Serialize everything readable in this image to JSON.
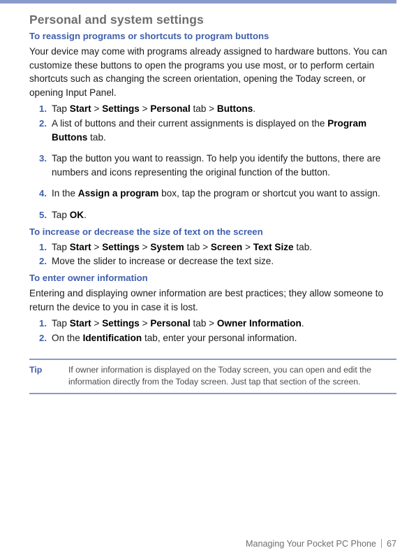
{
  "document": {
    "title": "Personal and system settings",
    "sections": [
      {
        "heading": "To reassign programs or shortcuts to program buttons",
        "intro": "Your device may come with programs already assigned to hardware buttons. You can customize these buttons to open the programs you use most, or to perform certain shortcuts such as changing the screen orientation, opening the Today screen, or opening Input Panel.",
        "steps": [
          {
            "num": "1.",
            "parts": [
              {
                "t": "Tap ",
                "b": false
              },
              {
                "t": "Start",
                "b": true
              },
              {
                "t": " > ",
                "b": false
              },
              {
                "t": "Settings",
                "b": true
              },
              {
                "t": " > ",
                "b": false
              },
              {
                "t": "Personal",
                "b": true
              },
              {
                "t": " tab > ",
                "b": false
              },
              {
                "t": "Buttons",
                "b": true
              },
              {
                "t": ".",
                "b": false
              }
            ]
          },
          {
            "num": "2.",
            "parts": [
              {
                "t": "A list of buttons and their current assignments is displayed on the ",
                "b": false
              },
              {
                "t": "Program Buttons",
                "b": true
              },
              {
                "t": " tab.",
                "b": false
              }
            ]
          },
          {
            "num": "3.",
            "gap": true,
            "parts": [
              {
                "t": "Tap the button you want to reassign. To help you identify the buttons, there are numbers and icons representing the original function of the button.",
                "b": false
              }
            ]
          },
          {
            "num": "4.",
            "gap": true,
            "parts": [
              {
                "t": "In the ",
                "b": false
              },
              {
                "t": "Assign a program",
                "b": true
              },
              {
                "t": " box, tap the program or shortcut you want to assign.",
                "b": false
              }
            ]
          },
          {
            "num": "5.",
            "gap": true,
            "parts": [
              {
                "t": "Tap ",
                "b": false
              },
              {
                "t": "OK",
                "b": true
              },
              {
                "t": ".",
                "b": false
              }
            ]
          }
        ]
      },
      {
        "heading": "To increase or decrease the size of text on the screen",
        "steps": [
          {
            "num": "1.",
            "parts": [
              {
                "t": "Tap ",
                "b": false
              },
              {
                "t": "Start",
                "b": true
              },
              {
                "t": " > ",
                "b": false
              },
              {
                "t": "Settings",
                "b": true
              },
              {
                "t": " > ",
                "b": false
              },
              {
                "t": "System",
                "b": true
              },
              {
                "t": " tab > ",
                "b": false
              },
              {
                "t": "Screen",
                "b": true
              },
              {
                "t": " > ",
                "b": false
              },
              {
                "t": "Text Size",
                "b": true
              },
              {
                "t": " tab.",
                "b": false
              }
            ]
          },
          {
            "num": "2.",
            "parts": [
              {
                "t": "Move the slider to increase or decrease the text size.",
                "b": false
              }
            ]
          }
        ]
      },
      {
        "heading": "To enter owner information",
        "intro": "Entering and displaying owner information are best practices; they allow someone to return the device to you in case it is lost.",
        "steps": [
          {
            "num": "1.",
            "parts": [
              {
                "t": "Tap ",
                "b": false
              },
              {
                "t": "Start",
                "b": true
              },
              {
                "t": " > ",
                "b": false
              },
              {
                "t": "Settings",
                "b": true
              },
              {
                "t": " > ",
                "b": false
              },
              {
                "t": "Personal",
                "b": true
              },
              {
                "t": " tab > ",
                "b": false
              },
              {
                "t": "Owner Information",
                "b": true
              },
              {
                "t": ".",
                "b": false
              }
            ]
          },
          {
            "num": "2.",
            "parts": [
              {
                "t": "On the ",
                "b": false
              },
              {
                "t": "Identification",
                "b": true
              },
              {
                "t": " tab, enter your personal information.",
                "b": false
              }
            ]
          }
        ]
      }
    ],
    "tip": {
      "label": "Tip",
      "text": "If owner information is displayed on the Today screen, you can open and edit the information directly from the Today screen. Just tap that section of the screen."
    },
    "footer": {
      "chapter": "Managing Your Pocket PC Phone",
      "page_number": "67"
    },
    "colors": {
      "rule": "#8a9acb",
      "heading_blue": "#3f5fae",
      "title_gray": "#6e6e6e",
      "body": "#1a1a1a"
    }
  }
}
